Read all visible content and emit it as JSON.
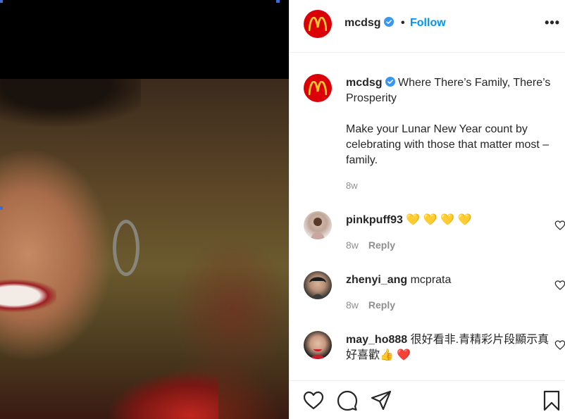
{
  "account": {
    "username": "mcdsg",
    "separator": "•",
    "follow_label": "Follow",
    "more_label": "•••"
  },
  "caption": {
    "username": "mcdsg",
    "title": "Where There’s Family, There’s Prosperity",
    "body": "Make your Lunar New Year count by celebrating with those that matter most – family.",
    "time": "8w"
  },
  "comments": [
    {
      "username": "pinkpuff93",
      "text": "💛 💛 💛 💛",
      "time": "8w",
      "reply": "Reply"
    },
    {
      "username": "zhenyi_ang",
      "text": "mcprata",
      "time": "8w",
      "reply": "Reply"
    },
    {
      "username": "may_ho888",
      "text": "很好看非.青精彩片段顯示真好喜歡👍 ❤️",
      "time": "",
      "reply": ""
    }
  ],
  "colors": {
    "brand": "#db0007",
    "arches": "#ffc72c",
    "link": "#0095f6",
    "verified": "#3897f0",
    "muted": "#8e8e8e"
  },
  "icons": [
    "mcdonalds-logo-icon",
    "verified-icon",
    "heart-icon",
    "comment-icon",
    "share-icon",
    "bookmark-icon"
  ]
}
